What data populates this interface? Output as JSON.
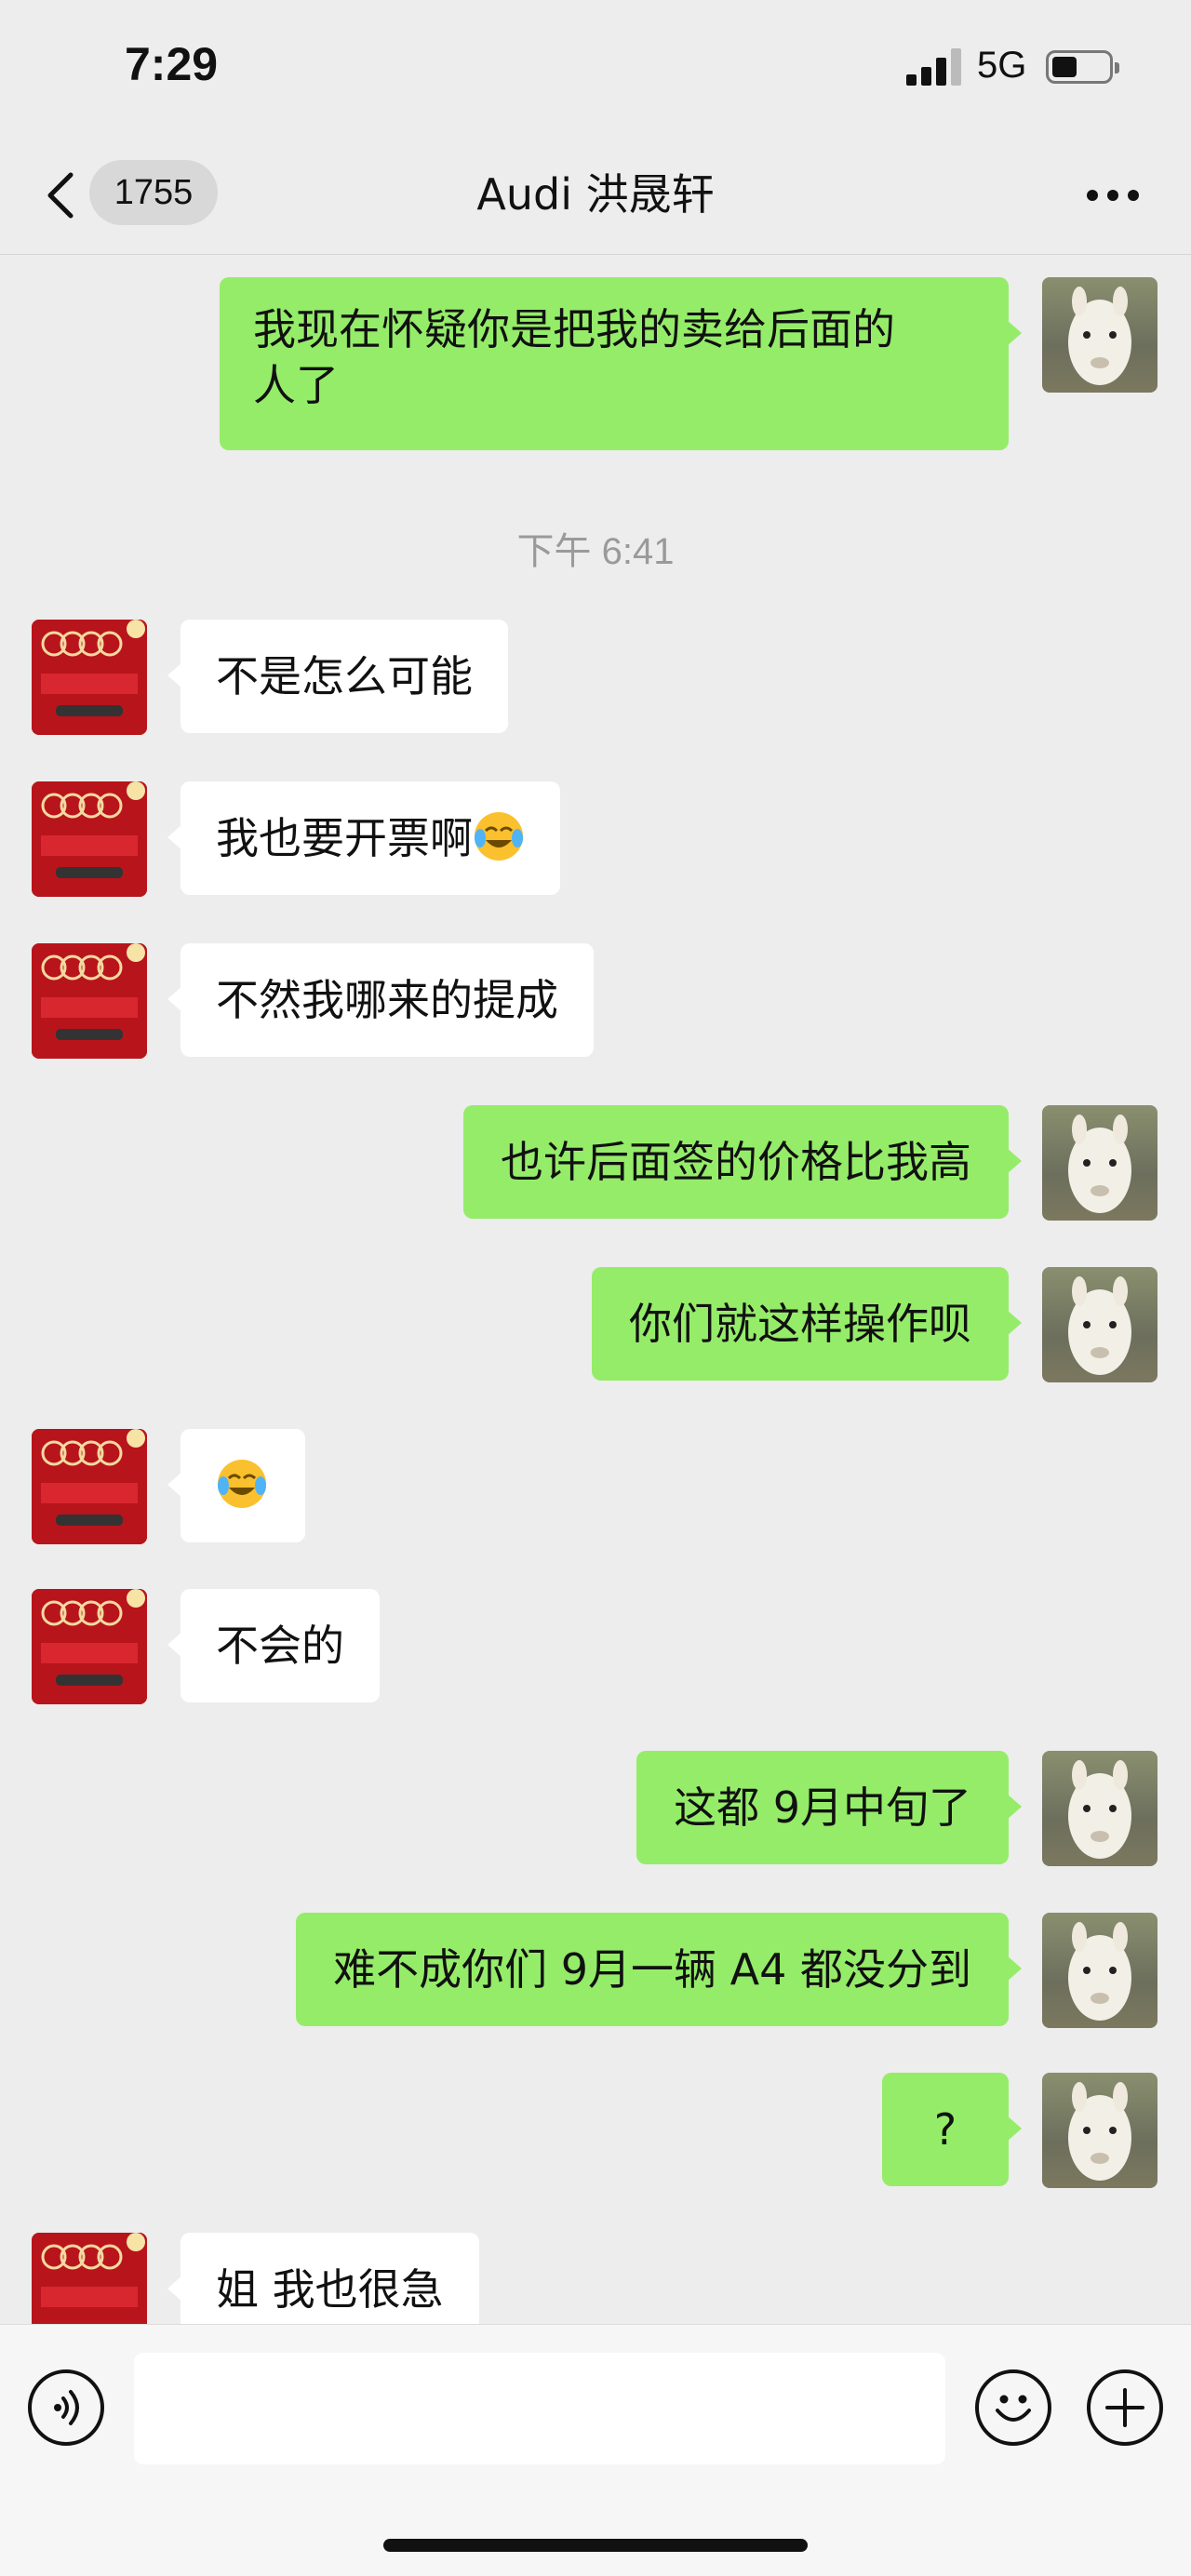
{
  "status_bar": {
    "time": "7:29",
    "network": "5G"
  },
  "nav": {
    "unread_count": "1755",
    "title": "Audi 洪晟轩"
  },
  "messages": [
    {
      "sender": "me",
      "lines": [
        "我现在怀疑你是把我的卖给后面的",
        "人了"
      ]
    },
    {
      "sender": "them",
      "text": "不是怎么可能"
    },
    {
      "sender": "them",
      "text": "我也要开票啊",
      "emoji": "crying-laughing-emoji"
    },
    {
      "sender": "them",
      "text": "不然我哪来的提成"
    },
    {
      "sender": "me",
      "text": "也许后面签的价格比我高"
    },
    {
      "sender": "me",
      "text": "你们就这样操作呗"
    },
    {
      "sender": "them",
      "text": "",
      "emoji": "crying-laughing-emoji"
    },
    {
      "sender": "them",
      "text": "不会的"
    },
    {
      "sender": "me",
      "text": "这都 9月中旬了"
    },
    {
      "sender": "me",
      "text": "难不成你们 9月一辆 A4 都没分到"
    },
    {
      "sender": "me",
      "text": "?"
    },
    {
      "sender": "them",
      "text": "姐 我也很急"
    }
  ],
  "timestamp": "下午 6:41",
  "input": {
    "placeholder": ""
  },
  "icons": {
    "back": "chevron-left-icon",
    "more": "more-dots-icon",
    "voice": "voice-icon",
    "emoji": "emoji-icon",
    "plus": "plus-icon"
  },
  "colors": {
    "background": "#ededed",
    "my_bubble": "#95ec69",
    "their_bubble": "#ffffff",
    "timestamp": "#9a9a9a",
    "dealer_avatar": "#b8141c"
  }
}
